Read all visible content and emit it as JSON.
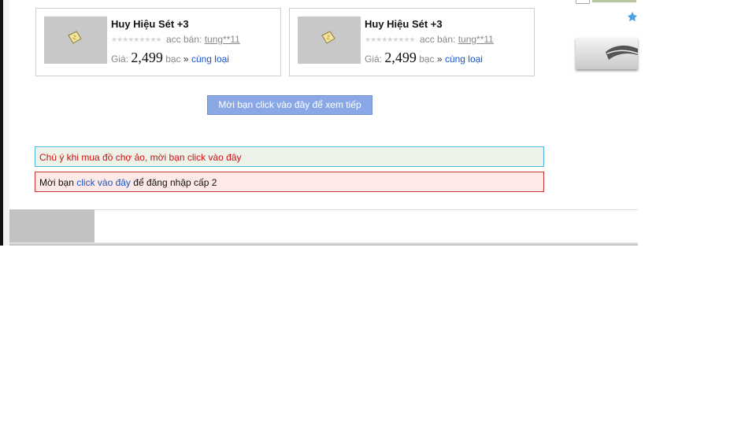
{
  "items": [
    {
      "name": "Huy Hiệu Sét +3",
      "stars": "★★★★★★★★★",
      "seller_label": "acc bán:",
      "seller": "tung**11",
      "price_label": "Giá:",
      "price": "2,499",
      "currency": "bạc",
      "raquo": "»",
      "same_type": "cùng loại"
    },
    {
      "name": "Huy Hiệu Sét +3",
      "stars": "★★★★★★★★★",
      "seller_label": "acc bán:",
      "seller": "tung**11",
      "price_label": "Giá:",
      "price": "2,499",
      "currency": "bạc",
      "raquo": "»",
      "same_type": "cùng loại"
    }
  ],
  "more_button": "Mời bạn click vào đây để xem tiếp",
  "notice_warning": "Chú ý khi mua đồ chợ ảo, mời bạn click vào đây",
  "notice_login": {
    "prefix": "Mời bạn",
    "link": "click vào đây",
    "suffix": "để đăng nhập cấp 2"
  },
  "colors": {
    "link": "#1a55c9",
    "warning_text": "#cc1111",
    "button_bg": "#8aa8e6"
  },
  "icons": {
    "item": "lightning-badge-icon",
    "side_badge": "blue-star-icon"
  }
}
